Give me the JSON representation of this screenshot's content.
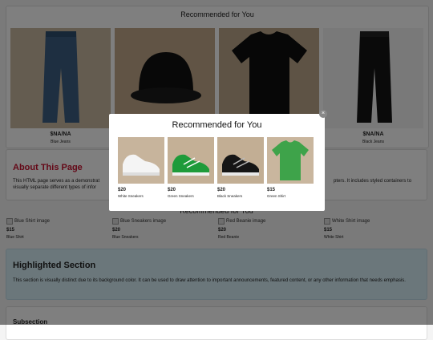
{
  "background": {
    "section_title": "Recommended for You",
    "products": [
      {
        "price": "$NA/NA",
        "name": "Blue Jeans",
        "icon": "jeans-icon"
      },
      {
        "price": "",
        "name": "",
        "icon": "cap-icon"
      },
      {
        "price": "",
        "name": "",
        "icon": "tshirt-icon"
      },
      {
        "price": "$NA/NA",
        "name": "Black Jeans",
        "icon": "jeans-icon"
      }
    ],
    "about": {
      "title": "About This Page",
      "text_left": "This HTML page serves as a demonstrat",
      "text_left2": "visually separate different types of infor",
      "text_right": "pters. It includes styled containers to"
    },
    "section2_title": "Recommended for You",
    "image_cards": [
      {
        "alt": "Blue Shirt image",
        "price": "$15",
        "name": "Blue Shirt"
      },
      {
        "alt": "Blue Sneakers image",
        "price": "$20",
        "name": "Blue Sneakers"
      },
      {
        "alt": "Red Beanie image",
        "price": "$20",
        "name": "Red Beanie"
      },
      {
        "alt": "White Shirt image",
        "price": "$15",
        "name": "White Shirt"
      }
    ],
    "highlight": {
      "title": "Highlighted Section",
      "text": "This section is visually distinct due to its background color. It can be used to draw attention to important announcements, featured content, or any other information that needs emphasis."
    },
    "subsection": {
      "title": "Subsection"
    }
  },
  "modal": {
    "title": "Recommended for You",
    "close_label": "×",
    "products": [
      {
        "price": "$20",
        "name": "White Sneakers",
        "icon": "sneaker-icon"
      },
      {
        "price": "$20",
        "name": "Green Sneakers",
        "icon": "sneaker-icon"
      },
      {
        "price": "$20",
        "name": "Black Sneakers",
        "icon": "sneaker-icon"
      },
      {
        "price": "$15",
        "name": "Green Shirt",
        "icon": "tshirt-icon"
      }
    ]
  },
  "colors": {
    "accent_red": "#c8102e",
    "highlight_bg": "#d6eef7",
    "overlay": "rgba(0,0,0,0.5)"
  }
}
